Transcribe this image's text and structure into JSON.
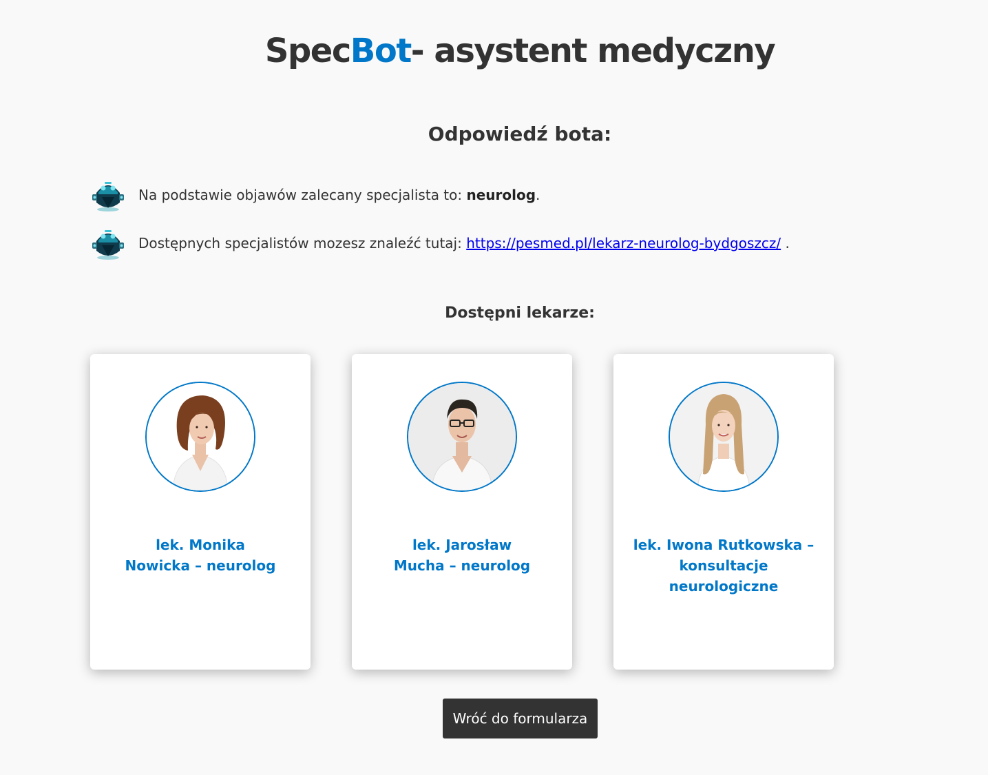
{
  "header": {
    "title_part1": "Spec",
    "title_accent": "Bot",
    "title_part2": "- asystent medyczny"
  },
  "answer": {
    "title": "Odpowiedź bota:",
    "messages": [
      {
        "icon": "robot-icon",
        "text_before": "Na podstawie objawów zalecany specjalista to: ",
        "bold": "neurolog",
        "text_after": "."
      },
      {
        "icon": "robot-icon",
        "text_before": "Dostępnych specjalistów mozesz znaleźć tutaj: ",
        "link": "https://pesmed.pl/lekarz-neurolog-bydgoszcz/",
        "text_after": " ."
      }
    ]
  },
  "doctors": {
    "title": "Dostępni lekarze:",
    "items": [
      {
        "name_line1": "lek. Monika",
        "name_line2": "Nowicka – neurolog",
        "photo": "doctor-photo-monika"
      },
      {
        "name_line1": "lek. Jarosław",
        "name_line2": "Mucha – neurolog",
        "photo": "doctor-photo-jaroslaw"
      },
      {
        "name_line1": "lek. Iwona Rutkowska –",
        "name_line2": "konsultacje neurologiczne",
        "photo": "doctor-photo-iwona"
      }
    ]
  },
  "actions": {
    "back_label": "Wróć do formularza"
  },
  "colors": {
    "accent": "#0077c8",
    "text": "#333333",
    "background": "#f9f9f9",
    "button": "#333333"
  }
}
